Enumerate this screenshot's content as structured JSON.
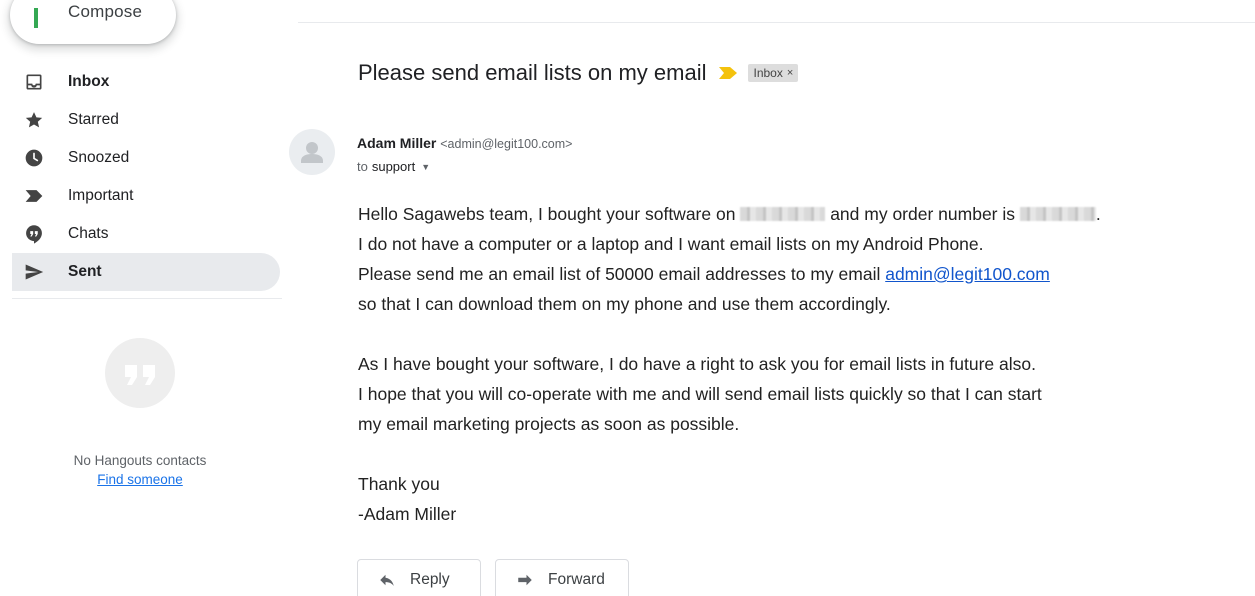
{
  "compose": {
    "label": "Compose"
  },
  "sidebar": {
    "items": [
      {
        "label": "Inbox",
        "icon": "inbox-icon",
        "bold": true,
        "active": false
      },
      {
        "label": "Starred",
        "icon": "star-icon",
        "bold": false,
        "active": false
      },
      {
        "label": "Snoozed",
        "icon": "clock-icon",
        "bold": false,
        "active": false
      },
      {
        "label": "Important",
        "icon": "important-icon",
        "bold": false,
        "active": false
      },
      {
        "label": "Chats",
        "icon": "chat-icon",
        "bold": false,
        "active": false
      },
      {
        "label": "Sent",
        "icon": "send-icon",
        "bold": true,
        "active": true
      }
    ]
  },
  "hangouts": {
    "icon": "hangouts-quote-icon",
    "empty_text": "No Hangouts contacts",
    "link_text": "Find someone"
  },
  "message": {
    "subject": "Please send email lists on my email",
    "label_chip": "Inbox",
    "label_close": "×",
    "sender_name": "Adam Miller",
    "sender_email": "<admin@legit100.com>",
    "to_prefix": "to",
    "to_name": "support",
    "body": {
      "line1_a": "Hello Sagawebs team, I bought your software on",
      "line1_b": "and my order number is",
      "line1_end": ".",
      "line2": "I do not have a computer or a laptop and I want email lists on my Android Phone.",
      "line3_a": "Please send me an email list of 50000 email addresses to my email",
      "line3_link": "admin@legit100.com",
      "line4": "so that I can download them on my phone and use them accordingly.",
      "line5": "As I have bought your software, I do have a right to ask you for email lists in future also.",
      "line6": "I hope that you will co-operate with me and will send email lists quickly so that I can start",
      "line7": "my email marketing projects as soon as possible.",
      "line8": "Thank you",
      "line9": "-Adam Miller"
    }
  },
  "actions": {
    "reply": "Reply",
    "forward": "Forward"
  },
  "colors": {
    "accent_green": "#34a853",
    "importance_yellow": "#f4c20d",
    "link_blue": "#1155cc",
    "active_nav_bg": "#e8eaed"
  }
}
